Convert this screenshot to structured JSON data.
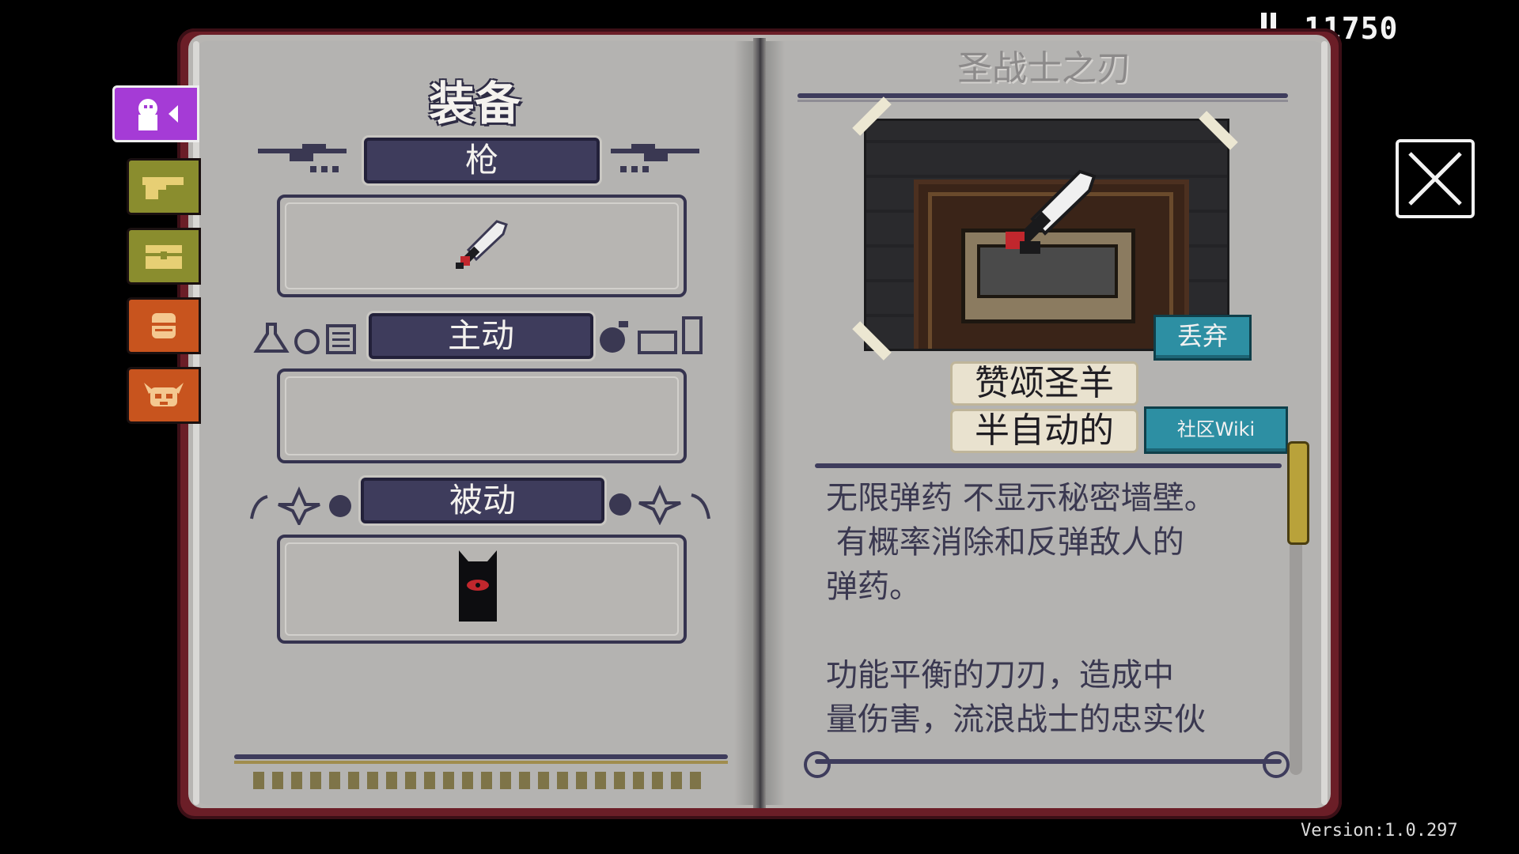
{
  "hud": {
    "score": "11750",
    "version": "Version:1.0.297"
  },
  "tabs": [
    {
      "id": "equipment",
      "icon": "player-silhouette-icon",
      "active": true,
      "color": "#a53bd6"
    },
    {
      "id": "guns",
      "icon": "revolver-icon",
      "active": false,
      "color": "#8a8d2e"
    },
    {
      "id": "items",
      "icon": "chest-icon",
      "active": false,
      "color": "#8a8d2e"
    },
    {
      "id": "npcs",
      "icon": "knight-helmet-icon",
      "active": false,
      "color": "#c8541e"
    },
    {
      "id": "bosses",
      "icon": "horned-skull-icon",
      "active": false,
      "color": "#c8541e"
    }
  ],
  "left_page": {
    "title": "装备",
    "sections": [
      {
        "label": "枪",
        "item_icon": "sword-icon"
      },
      {
        "label": "主动",
        "item_icon": ""
      },
      {
        "label": "被动",
        "item_icon": "dark-cloak-icon"
      }
    ]
  },
  "right_page": {
    "item_name": "圣战士之刃",
    "drop_button": "丢弃",
    "tags": [
      "赞颂圣羊",
      "半自动的"
    ],
    "wiki_button": "社区Wiki",
    "description": "无限弹药 不显示秘密墙壁。\n 有概率消除和反弹敌人的\n弹药。\n\n功能平衡的刀刃，造成中\n量伤害，流浪战士的忠实伙"
  },
  "colors": {
    "accent_purple": "#a53bd6",
    "book_red": "#6b1e27",
    "teal": "#2d8fa3",
    "label_navy": "#3e3c5c"
  }
}
